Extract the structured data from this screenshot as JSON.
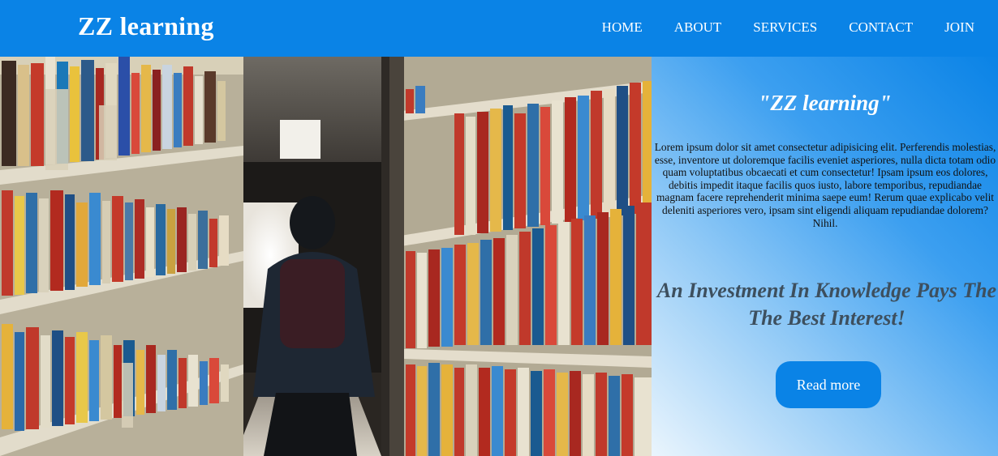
{
  "header": {
    "brand": "ZZ learning",
    "nav": [
      "HOME",
      "ABOUT",
      "SERVICES",
      "CONTACT",
      "JOIN"
    ]
  },
  "hero": {
    "image_alt": "Library aisle with student walking between bookshelves"
  },
  "panel": {
    "title": "\"ZZ learning\"",
    "body": "Lorem ipsum dolor sit amet consectetur adipisicing elit. Perferendis molestias, esse, inventore ut doloremque facilis eveniet asperiores, nulla dicta totam odio quam voluptatibus obcaecati et cum consectetur! Ipsam ipsum eos dolores, debitis impedit itaque facilis quos iusto, labore temporibus, repudiandae magnam facere reprehenderit minima saepe eum! Rerum quae explicabo velit deleniti asperiores vero, ipsam sint eligendi aliquam repudiandae dolorem? Nihil.",
    "tagline": "An Investment In Knowledge Pays The The Best Interest!",
    "button": "Read more"
  },
  "colors": {
    "primary": "#0a83e6",
    "tagline": "#3d4f5e"
  }
}
